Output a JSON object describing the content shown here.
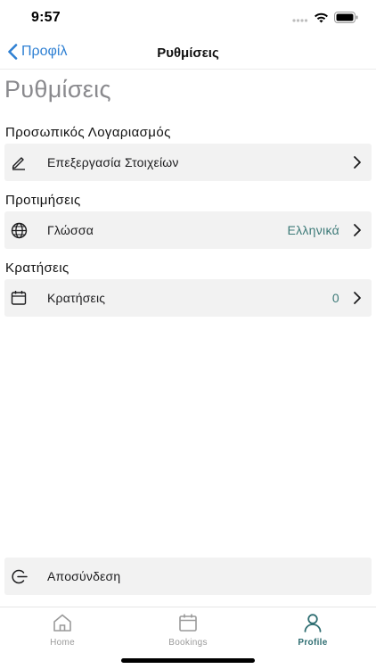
{
  "status_bar": {
    "time": "9:57"
  },
  "nav": {
    "back_label": "Προφίλ",
    "title": "Ρυθμίσεις"
  },
  "page": {
    "large_title": "Ρυθμίσεις"
  },
  "sections": {
    "account": {
      "header": "Προσωπικός Λογαριασμός",
      "rows": [
        {
          "label": "Επεξεργασία Στοιχείων",
          "icon": "pencil-icon"
        }
      ]
    },
    "preferences": {
      "header": "Προτιμήσεις",
      "rows": [
        {
          "label": "Γλώσσα",
          "value": "Ελληνικά",
          "icon": "globe-icon"
        }
      ]
    },
    "bookings": {
      "header": "Κρατήσεις",
      "rows": [
        {
          "label": "Κρατήσεις",
          "value": "0",
          "icon": "calendar-icon"
        }
      ]
    }
  },
  "logout": {
    "label": "Αποσύνδεση",
    "icon": "logout-icon"
  },
  "tab_bar": {
    "tabs": [
      {
        "label": "Home",
        "icon": "home-icon",
        "active": false
      },
      {
        "label": "Bookings",
        "icon": "calendar-icon",
        "active": false
      },
      {
        "label": "Profile",
        "icon": "person-icon",
        "active": true
      }
    ]
  },
  "colors": {
    "accent_blue": "#2f80d3",
    "value_teal": "#3d7a78",
    "active_tab": "#2f6e72",
    "row_bg": "#f2f2f2"
  }
}
